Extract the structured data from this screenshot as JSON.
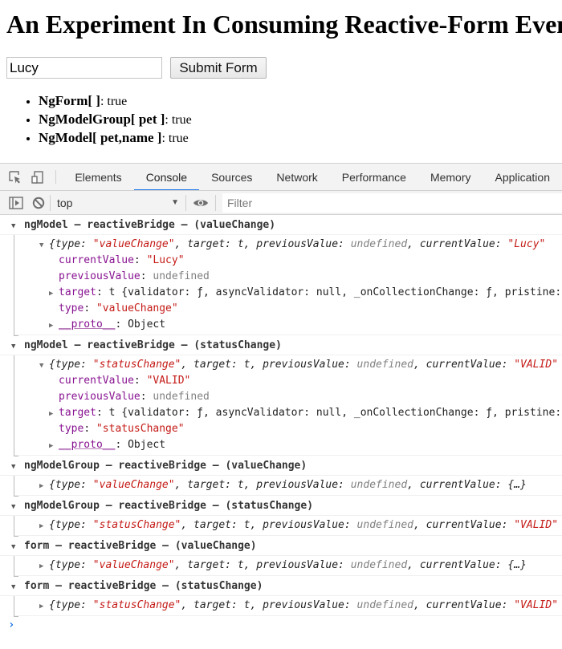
{
  "page": {
    "title": "An Experiment In Consuming Reactive-Form Events",
    "input_value": "Lucy",
    "submit_label": "Submit Form",
    "status_items": [
      {
        "label": "NgForm[ ]",
        "value": ": true"
      },
      {
        "label": "NgModelGroup[ pet ]",
        "value": ": true"
      },
      {
        "label": "NgModel[ pet,name ]",
        "value": ": true"
      }
    ]
  },
  "devtools": {
    "tabs": [
      "Elements",
      "Console",
      "Sources",
      "Network",
      "Performance",
      "Memory",
      "Application"
    ],
    "active_tab": "Console",
    "context": "top",
    "filter_placeholder": "Filter",
    "colors": {
      "accent": "#1a73e8",
      "key": "#881391",
      "string": "#c41a16",
      "undefined": "#808080"
    },
    "groups": [
      {
        "header": "ngModel – reactiveBridge – (valueChange)",
        "summary": {
          "type": "\"valueChange\"",
          "target": "t",
          "previousValue": "undefined",
          "currentValue": "\"Lucy\""
        },
        "props": {
          "currentValue": "\"Lucy\"",
          "previousValue": "undefined",
          "target": "t {validator: ƒ, asyncValidator: null, _onCollectionChange: ƒ, pristine: true, …}",
          "type": "\"valueChange\"",
          "proto": "Object"
        }
      },
      {
        "header": "ngModel – reactiveBridge – (statusChange)",
        "summary": {
          "type": "\"statusChange\"",
          "target": "t",
          "previousValue": "undefined",
          "currentValue": "\"VALID\""
        },
        "props": {
          "currentValue": "\"VALID\"",
          "previousValue": "undefined",
          "target": "t {validator: ƒ, asyncValidator: null, _onCollectionChange: ƒ, pristine: true, …}",
          "type": "\"statusChange\"",
          "proto": "Object"
        }
      },
      {
        "header": "ngModelGroup – reactiveBridge – (valueChange)",
        "summary": {
          "type": "\"valueChange\"",
          "target": "t",
          "previousValue": "undefined",
          "currentValue": "{…}"
        }
      },
      {
        "header": "ngModelGroup – reactiveBridge – (statusChange)",
        "summary": {
          "type": "\"statusChange\"",
          "target": "t",
          "previousValue": "undefined",
          "currentValue": "\"VALID\""
        }
      },
      {
        "header": "form – reactiveBridge – (valueChange)",
        "summary": {
          "type": "\"valueChange\"",
          "target": "t",
          "previousValue": "undefined",
          "currentValue": "{…}"
        }
      },
      {
        "header": "form – reactiveBridge – (statusChange)",
        "summary": {
          "type": "\"statusChange\"",
          "target": "t",
          "previousValue": "undefined",
          "currentValue": "\"VALID\""
        }
      }
    ],
    "prompt_symbol": "›"
  }
}
